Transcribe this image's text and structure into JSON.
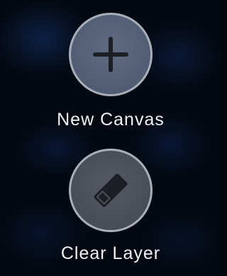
{
  "actions": [
    {
      "label": "New Canvas",
      "icon": "plus-icon"
    },
    {
      "label": "Clear Layer",
      "icon": "eraser-icon"
    }
  ],
  "colors": {
    "button_border": "#a9afb9",
    "new_canvas_fill": "#5a667c",
    "clear_layer_fill": "#4c5159",
    "icon": "#1c1f26",
    "label_text": "#f1f1f3",
    "background": "#040810"
  }
}
